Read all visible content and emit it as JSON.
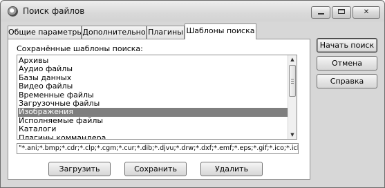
{
  "window": {
    "title": "Поиск файлов"
  },
  "tabs": [
    {
      "label": "Общие параметры"
    },
    {
      "label": "Дополнительно"
    },
    {
      "label": "Плагины"
    },
    {
      "label": "Шаблоны поиска"
    }
  ],
  "active_tab": "Шаблоны поиска",
  "templates": {
    "label": "Сохранённые шаблоны поиска:",
    "items": [
      "Архивы",
      "Аудио файлы",
      "Базы данных",
      "Видео файлы",
      "Временные файлы",
      "Загрузочные файлы",
      "Изображения",
      "Исполняемые файлы",
      "Каталоги",
      "Плагины коммандера"
    ],
    "selected": "Изображения"
  },
  "extensions_value": "\"*.ani;*.bmp;*.cdr;*.clp;*.cgm;*.cur;*.dib;*.djvu;*.drw;*.dxf;*.emf;*.eps;*.gif;*.ico;*.icl;*.iff;*.im",
  "buttons": {
    "load": "Загрузить",
    "save": "Сохранить",
    "delete": "Удалить",
    "start": "Начать поиск",
    "cancel": "Отмена",
    "help": "Справка"
  }
}
